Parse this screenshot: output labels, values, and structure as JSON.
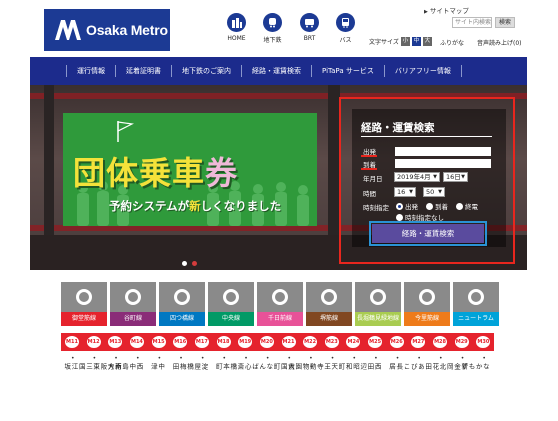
{
  "header": {
    "logo_text": "Osaka Metro",
    "sitemap": "サイトマップ",
    "search_placeholder": "サイト内検索",
    "search_button": "検索",
    "icon_nav": [
      {
        "label": "HOME",
        "icon": "building-icon"
      },
      {
        "label": "地下鉄",
        "icon": "subway-icon"
      },
      {
        "label": "BRT",
        "icon": "brt-icon"
      },
      {
        "label": "バス",
        "icon": "bus-icon"
      }
    ],
    "text_size_label": "文字サイズ",
    "text_sizes": [
      "小",
      "中",
      "大"
    ],
    "furigana": "ふりがな",
    "voice": "音声読み上げ(0)"
  },
  "nav": {
    "items": [
      "運行情報",
      "延着証明書",
      "地下鉄のご案内",
      "経路・運賃検索",
      "PiTaPa サービス",
      "バリアフリー情報"
    ]
  },
  "banner": {
    "title_main": "団体乗車",
    "title_accent": "券",
    "subtitle_pre": "予約システムが",
    "subtitle_accent": "新",
    "subtitle_post": "しくなりました"
  },
  "route_search": {
    "title": "経路・運賃検索",
    "from_label": "出発",
    "to_label": "到着",
    "date_label": "年月日",
    "year_month": "2019年4月",
    "day": "16日",
    "time_label": "時間",
    "hour": "16",
    "minute": "50",
    "time_spec_label": "時刻指定",
    "options": [
      "出発",
      "到着",
      "終電",
      "時刻指定なし"
    ],
    "selected_option": "出発",
    "button": "経路・運賃検索"
  },
  "lines": [
    {
      "name": "御堂筋線",
      "color": "#e5232d"
    },
    {
      "name": "谷町線",
      "color": "#8a2c78"
    },
    {
      "name": "四つ橋線",
      "color": "#0078c2"
    },
    {
      "name": "中央線",
      "color": "#019a66"
    },
    {
      "name": "千日前線",
      "color": "#e85298"
    },
    {
      "name": "堺筋線",
      "color": "#814721"
    },
    {
      "name": "長堀鶴見緑地線",
      "color": "#a9cc51"
    },
    {
      "name": "今里筋線",
      "color": "#ee7b1a"
    },
    {
      "name": "ニュートラム",
      "color": "#00a3d9"
    }
  ],
  "stations": [
    {
      "code": "M11",
      "name": "江坂"
    },
    {
      "code": "M12",
      "name": "東三国"
    },
    {
      "code": "M13",
      "name": "新大阪"
    },
    {
      "code": "M14",
      "name": "西中島南方"
    },
    {
      "code": "M15",
      "name": "中津"
    },
    {
      "code": "M16",
      "name": "梅田"
    },
    {
      "code": "M17",
      "name": "淀屋橋"
    },
    {
      "code": "M18",
      "name": "本町"
    },
    {
      "code": "M19",
      "name": "心斎橋"
    },
    {
      "code": "M20",
      "name": "なんば"
    },
    {
      "code": "M21",
      "name": "大国町"
    },
    {
      "code": "M22",
      "name": "動物園前"
    },
    {
      "code": "M23",
      "name": "天王寺"
    },
    {
      "code": "M24",
      "name": "昭和町"
    },
    {
      "code": "M25",
      "name": "西田辺"
    },
    {
      "code": "M26",
      "name": "長居"
    },
    {
      "code": "M27",
      "name": "あびこ"
    },
    {
      "code": "M28",
      "name": "北花田"
    },
    {
      "code": "M29",
      "name": "新金岡"
    },
    {
      "code": "M30",
      "name": "なかもず"
    }
  ]
}
